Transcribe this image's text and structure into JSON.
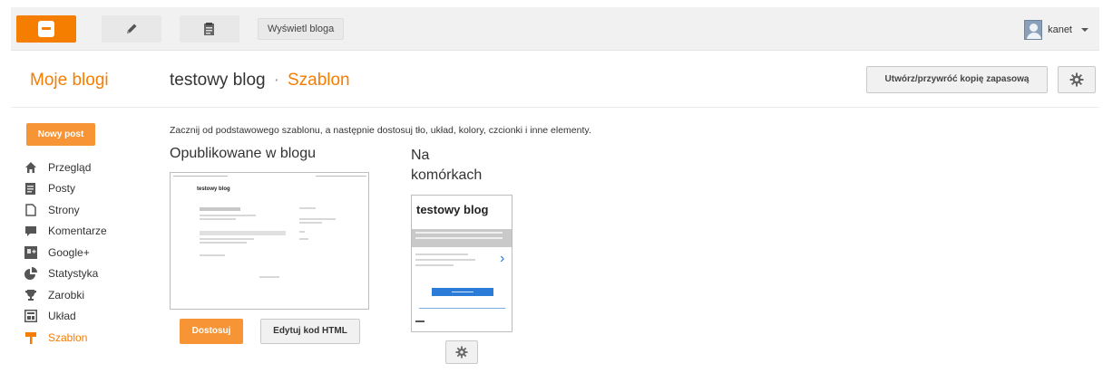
{
  "colors": {
    "accent": "#f57d00",
    "button_orange": "#f79435",
    "link_blue": "#2b7bd9"
  },
  "topbar": {
    "logo_icon": "blogger-logo-icon",
    "compose_icon": "pencil-icon",
    "posts_icon": "clipboard-icon",
    "view_blog_label": "Wyświetl bloga",
    "user_name": "kanet",
    "user_caret_icon": "chevron-down-icon"
  },
  "header": {
    "my_blogs": "Moje blogi",
    "blog_name": "testowy blog",
    "separator": "·",
    "section": "Szablon",
    "backup_label": "Utwórz/przywróć kopię zapasową",
    "settings_icon": "gear-icon"
  },
  "sidebar": {
    "new_post_label": "Nowy post",
    "items": [
      {
        "label": "Przegląd",
        "icon": "home-icon"
      },
      {
        "label": "Posty",
        "icon": "posts-icon"
      },
      {
        "label": "Strony",
        "icon": "page-icon"
      },
      {
        "label": "Komentarze",
        "icon": "comment-icon"
      },
      {
        "label": "Google+",
        "icon": "google-plus-icon"
      },
      {
        "label": "Statystyka",
        "icon": "pie-chart-icon"
      },
      {
        "label": "Zarobki",
        "icon": "trophy-icon"
      },
      {
        "label": "Układ",
        "icon": "layout-icon"
      },
      {
        "label": "Szablon",
        "icon": "template-icon"
      }
    ]
  },
  "main": {
    "intro_text": "Zacznij od podstawowego szablonu, a następnie dostosuj tło, układ, kolory, czcionki i inne elementy.",
    "published_heading": "Opublikowane w blogu",
    "mobile_heading": "Na komórkach",
    "desktop_preview_title": "testowy blog",
    "mobile_preview_title": "testowy blog",
    "customize_label": "Dostosuj",
    "edit_html_label": "Edytuj kod HTML",
    "mobile_settings_icon": "gear-icon"
  }
}
